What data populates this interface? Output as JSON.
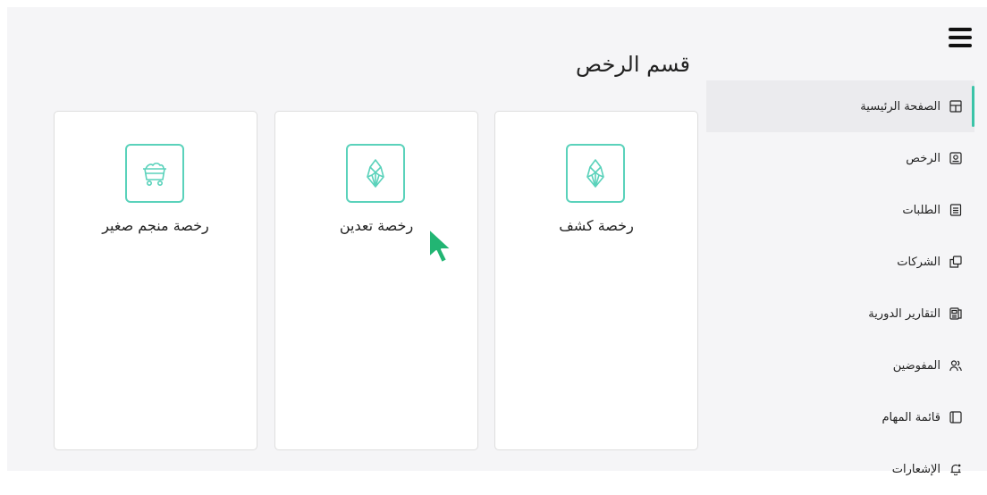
{
  "header": {
    "page_title": "قسم الرخص"
  },
  "sidebar": {
    "items": [
      {
        "label": "الصفحة الرئيسية",
        "icon": "layout-icon",
        "active": true
      },
      {
        "label": "الرخص",
        "icon": "license-icon",
        "active": false
      },
      {
        "label": "الطلبات",
        "icon": "requests-icon",
        "active": false
      },
      {
        "label": "الشركات",
        "icon": "companies-icon",
        "active": false
      },
      {
        "label": "التقارير الدورية",
        "icon": "reports-icon",
        "active": false
      },
      {
        "label": "المفوضين",
        "icon": "users-icon",
        "active": false
      },
      {
        "label": "قائمة المهام",
        "icon": "tasks-icon",
        "active": false
      },
      {
        "label": "الإشعارات",
        "icon": "bell-icon",
        "active": false
      }
    ]
  },
  "cards": [
    {
      "title": "رخصة كشف",
      "icon": "crystal-icon"
    },
    {
      "title": "رخصة تعدين",
      "icon": "crystal-icon"
    },
    {
      "title": "رخصة منجم صغير",
      "icon": "mine-cart-icon"
    }
  ],
  "colors": {
    "accent": "#3bc4a8",
    "icon_border": "#5ad2bb",
    "cursor": "#22b573"
  }
}
